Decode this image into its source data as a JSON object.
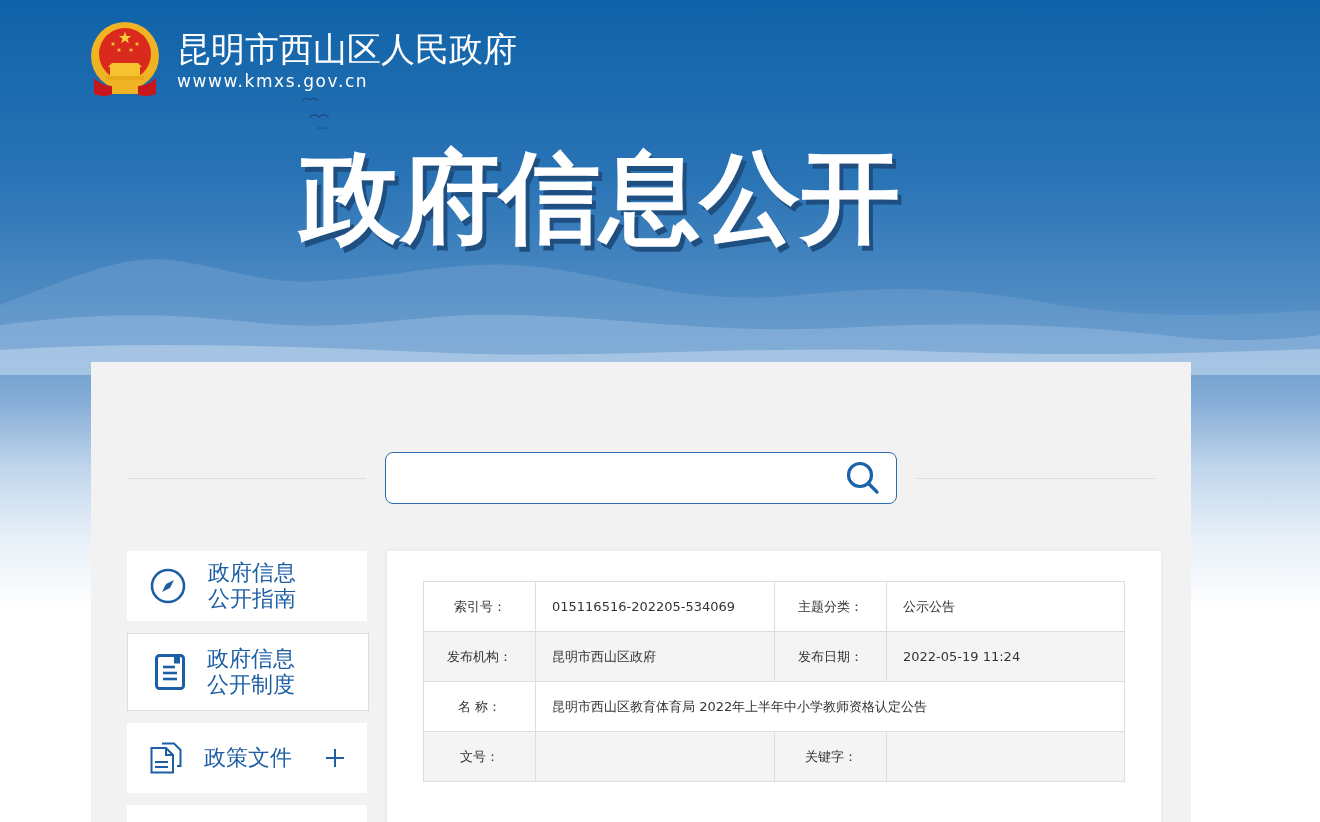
{
  "header": {
    "site_title": "昆明市西山区人民政府",
    "site_url": "wwww.kmxs.gov.cn"
  },
  "banner": {
    "title": "政府信息公开"
  },
  "sidebar": {
    "items": [
      {
        "label": "政府信息公开指南",
        "selected": false,
        "expandable": false
      },
      {
        "label": "政府信息公开制度",
        "selected": true,
        "expandable": false
      },
      {
        "label": "政策文件",
        "selected": false,
        "expandable": true
      }
    ]
  },
  "info_table": {
    "rows": [
      {
        "cells": [
          {
            "label": "索引号：",
            "value": "015116516-202205-534069"
          },
          {
            "label": "主题分类：",
            "value": "公示公告"
          }
        ]
      },
      {
        "cells": [
          {
            "label": "发布机构：",
            "value": "昆明市西山区政府"
          },
          {
            "label": "发布日期：",
            "value": "2022-05-19 11:24"
          }
        ]
      },
      {
        "cells": [
          {
            "label": "名 称：",
            "value": "昆明市西山区教育体育局 2022年上半年中小学教师资格认定公告"
          }
        ]
      },
      {
        "cells": [
          {
            "label": "文号："
          },
          {
            "label": "关键字："
          }
        ]
      }
    ]
  }
}
